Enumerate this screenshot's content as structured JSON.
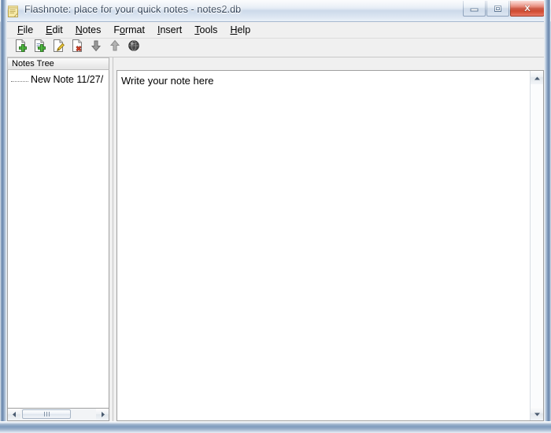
{
  "window": {
    "title": "Flashnote: place for your quick notes - notes2.db",
    "app_icon": "note-icon",
    "controls": {
      "minimize": "minimize-icon",
      "maximize": "maximize-icon",
      "close": "close-icon"
    }
  },
  "menubar": {
    "items": [
      {
        "label": "File",
        "mnemonic": "F"
      },
      {
        "label": "Edit",
        "mnemonic": "E"
      },
      {
        "label": "Notes",
        "mnemonic": "N"
      },
      {
        "label": "Format",
        "mnemonic": "o"
      },
      {
        "label": "Insert",
        "mnemonic": "I"
      },
      {
        "label": "Tools",
        "mnemonic": "T"
      },
      {
        "label": "Help",
        "mnemonic": "H"
      }
    ]
  },
  "toolbar": {
    "buttons": [
      {
        "name": "new-note-icon",
        "label": "New Note"
      },
      {
        "name": "new-subnote-icon",
        "label": "New Subnote"
      },
      {
        "name": "edit-note-icon",
        "label": "Edit Note"
      },
      {
        "name": "delete-note-icon",
        "label": "Delete Note"
      },
      {
        "name": "move-down-icon",
        "label": "Move Down"
      },
      {
        "name": "move-up-icon",
        "label": "Move Up"
      },
      {
        "name": "globe-icon",
        "label": "Web"
      }
    ]
  },
  "tree": {
    "header": "Notes Tree",
    "nodes": [
      {
        "label": "New Note 11/27/"
      }
    ],
    "hscrollbar": {
      "left_arrow": "scroll-left-icon",
      "right_arrow": "scroll-right-icon"
    }
  },
  "editor": {
    "text": "Write your note here",
    "vscrollbar": {
      "up_arrow": "scroll-up-icon",
      "down_arrow": "scroll-down-icon"
    }
  },
  "colors": {
    "title_text": "#27384e",
    "close_button": "#c13a24",
    "panel_background": "#f0f0f0",
    "content_background": "#ffffff",
    "new_badge": "#3aa03a",
    "delete_badge": "#c8402a"
  }
}
